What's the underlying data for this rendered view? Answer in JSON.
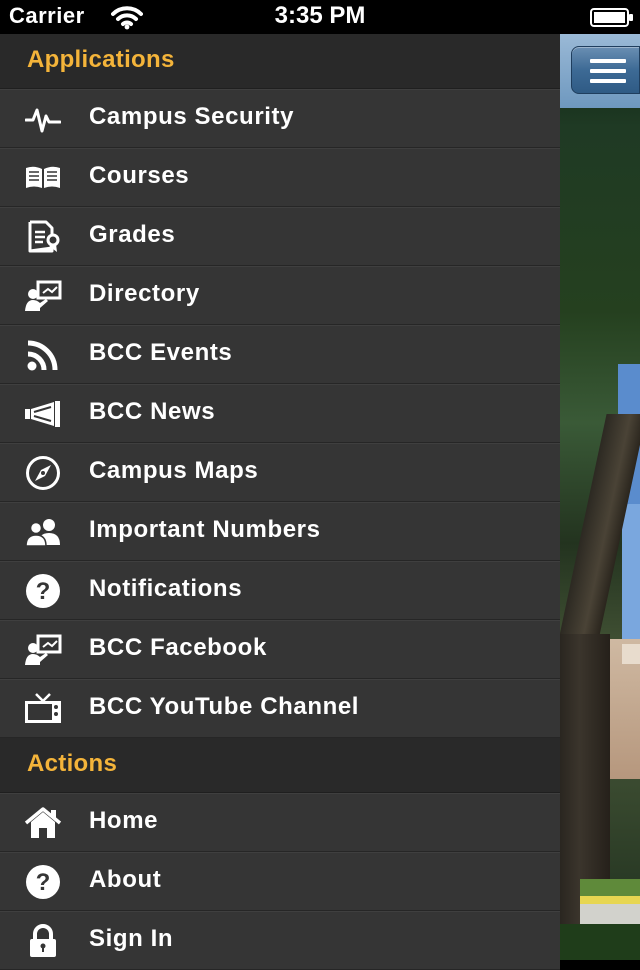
{
  "status_bar": {
    "carrier": "Carrier",
    "time": "3:35 PM",
    "icons": [
      "wifi-icon",
      "battery-icon"
    ]
  },
  "drawer": {
    "sections": [
      {
        "header": "Applications",
        "items": [
          {
            "label": "Campus Security",
            "icon": "heartbeat-icon"
          },
          {
            "label": "Courses",
            "icon": "book-icon"
          },
          {
            "label": "Grades",
            "icon": "certificate-document-icon"
          },
          {
            "label": "Directory",
            "icon": "presenter-icon"
          },
          {
            "label": "BCC Events",
            "icon": "rss-icon"
          },
          {
            "label": "BCC News",
            "icon": "megaphone-icon"
          },
          {
            "label": "Campus Maps",
            "icon": "compass-icon"
          },
          {
            "label": "Important Numbers",
            "icon": "people-icon"
          },
          {
            "label": "Notifications",
            "icon": "question-circle-icon"
          },
          {
            "label": "BCC Facebook",
            "icon": "presenter-icon"
          },
          {
            "label": "BCC YouTube Channel",
            "icon": "tv-icon"
          }
        ]
      },
      {
        "header": "Actions",
        "items": [
          {
            "label": "Home",
            "icon": "home-icon"
          },
          {
            "label": "About",
            "icon": "question-circle-icon"
          },
          {
            "label": "Sign In",
            "icon": "lock-icon"
          }
        ]
      }
    ]
  },
  "menu_button": {
    "icon": "hamburger-icon"
  },
  "colors": {
    "section_header_text": "#f4b43a",
    "drawer_background": "#343434",
    "menu_button": "#3d6a95"
  }
}
